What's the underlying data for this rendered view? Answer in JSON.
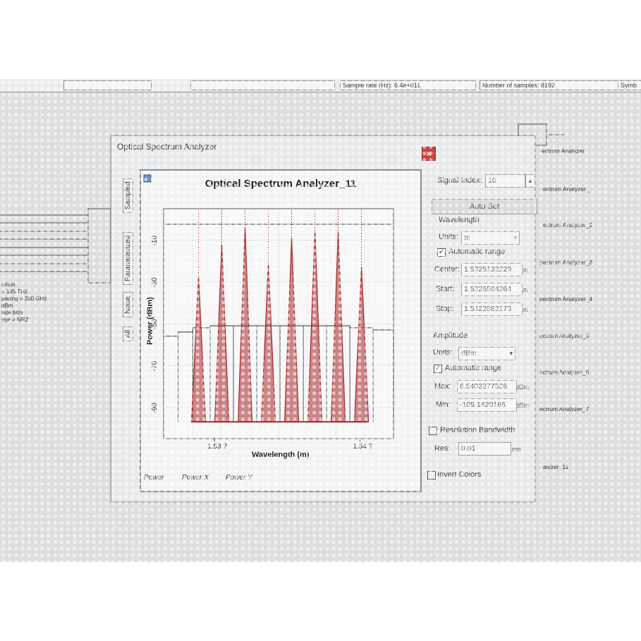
{
  "top_bar": {
    "sample_rate": "Sample rate (Hz):  6.4e+011",
    "num_samples": "Number of samples:  8192",
    "symbol": "Symb"
  },
  "background": {
    "transmitter_lines": [
      "mitter",
      "= 195  THz",
      "pacing = 200  GHz",
      "  dBm",
      "rate  bit/s",
      "ype = NRZ"
    ],
    "analyzer_labels": [
      "ectrum Analyzer",
      "ectrum Analyzer_",
      "ectrum Analyzer_2",
      "pectrum Analyzer_3",
      "pectrum Analyzer_4",
      "ectrum Analyzer_5",
      "ectrum Analyzer_6",
      "ectrum Analyzer_7",
      "alyzer_11"
    ]
  },
  "dialog": {
    "title": "Optical Spectrum Analyzer",
    "close_glyph": "×"
  },
  "graph": {
    "title": "Optical Spectrum Analyzer_11",
    "side_tabs": [
      "Sampled",
      "Parameterized",
      "Noise",
      "All"
    ],
    "bottom_tabs": [
      "Power",
      "Power X",
      "Power Y"
    ],
    "accent": "#a8282b"
  },
  "chart_data": {
    "type": "line",
    "title": "Optical Spectrum Analyzer_11",
    "xlabel": "Wavelength (m)",
    "ylabel": "Power (dBm)",
    "xlim": [
      1.5265e-06,
      1.5423e-06
    ],
    "ylim": [
      -105,
      5
    ],
    "y_ticks": [
      -10,
      -30,
      -50,
      -70,
      -90
    ],
    "x_ticks": [
      {
        "value": 1.53e-06,
        "label": "1.53 ?"
      },
      {
        "value": 1.54e-06,
        "label": "1.54 ?"
      }
    ],
    "grid": true,
    "series": [
      {
        "peak_wavelengths_um": [
          1.5289,
          1.5305,
          1.5321,
          1.5337,
          1.5353,
          1.5369,
          1.5385,
          1.5401
        ],
        "peak_power_dbm": [
          -27,
          -12,
          -4,
          -21,
          -9,
          -5,
          -6,
          -23
        ],
        "floor_dbm": -97,
        "color": "#a8282b"
      },
      {
        "step_x_um": [
          1.5265,
          1.5275,
          1.5285,
          1.5297,
          1.5313,
          1.5329,
          1.5345,
          1.5361,
          1.5377,
          1.5393,
          1.5409,
          1.5423
        ],
        "step_y_dbm": [
          -56,
          -54,
          -52,
          -51,
          -51,
          -51,
          -51,
          -51,
          -51,
          -52,
          -53,
          -53
        ],
        "color": "#333333"
      }
    ]
  },
  "properties": {
    "signal_index_label": "Signal Index:",
    "signal_index_value": "10",
    "auto_set": "Auto Set",
    "wavelength_section": "Wavelength",
    "units_label": "Units:",
    "units_value": "m",
    "auto_range_label": "Automatic range",
    "center_label": "Center:",
    "center_value": "1.5325132229",
    "start_label": "Start:",
    "start_value": "1.5226504364",
    "stop_label": "Stop:",
    "stop_value": "1.5422862173",
    "wl_unit": "m",
    "amplitude_section": "Amplitude",
    "amp_units_label": "Units:",
    "amp_units_value": "dBm",
    "amp_auto_range_label": "Automatic range",
    "max_label": "Max:",
    "max_value": "6.5403277526",
    "min_label": "Min:",
    "min_value": "-105.1420166",
    "amp_unit": "dBm",
    "resolution_label": "Resolution Bandwidth",
    "res_label": "Res:",
    "res_value": "0.01",
    "res_unit": "nm",
    "invert_colors_label": "Invert Colors"
  }
}
